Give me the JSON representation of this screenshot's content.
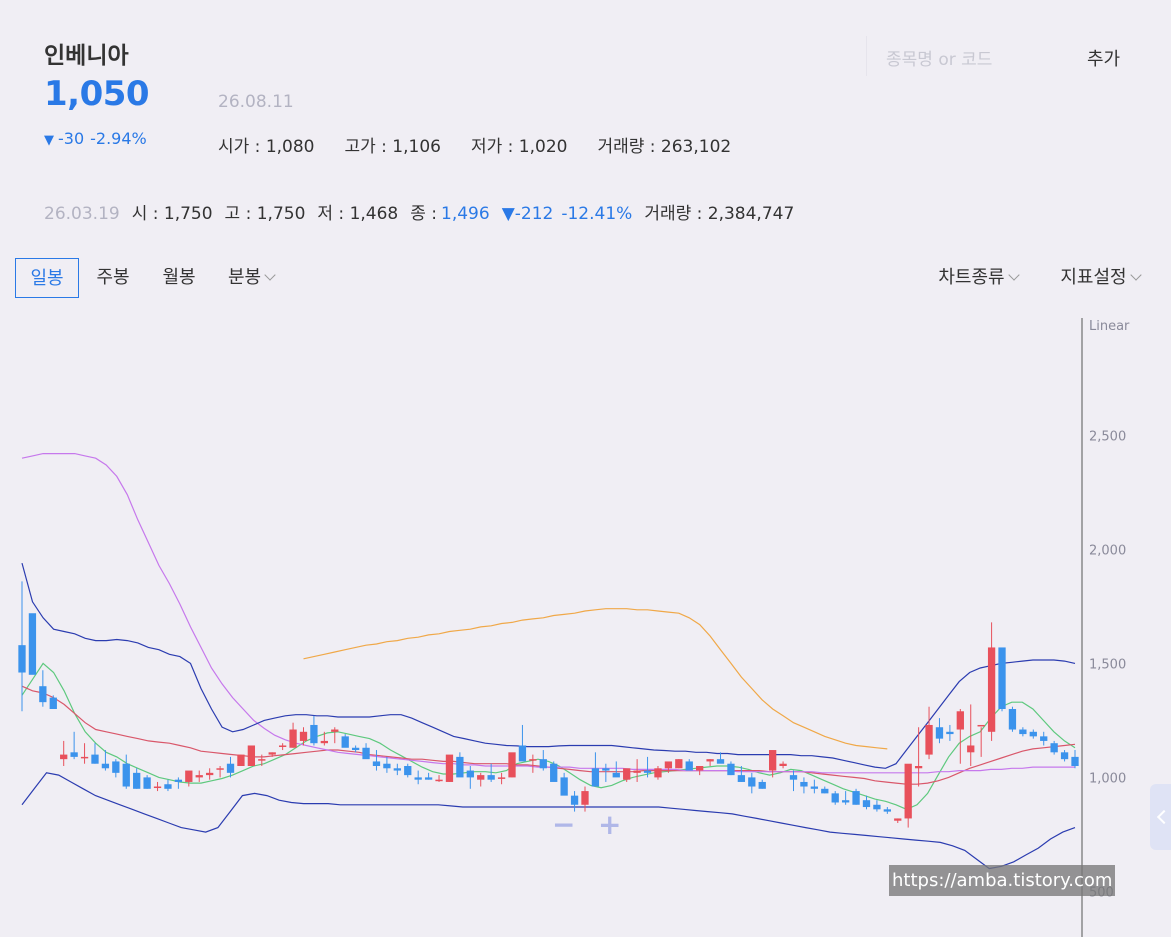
{
  "stock": {
    "name": "인베니아",
    "price": "1,050",
    "change_arrow": "▼",
    "change": "-30",
    "change_pct": "-2.94%",
    "date": "26.08.11",
    "open": "시가 : 1,080",
    "high": "고가 : 1,106",
    "low": "저가 : 1,020",
    "volume": "거래량 : 263,102"
  },
  "search": {
    "placeholder": "종목명 or 코드",
    "add_label": "추가"
  },
  "prev": {
    "date": "26.03.19",
    "open": "시 : 1,750",
    "high": "고 : 1,750",
    "low": "저 : 1,468",
    "close_label": "종 :",
    "close": "1,496",
    "change": "▼-212",
    "change_pct": "-12.41%",
    "volume": "거래량 : 2,384,747"
  },
  "tabs": {
    "daily": "일봉",
    "weekly": "주봉",
    "monthly": "월봉",
    "minute": "분봉"
  },
  "controls": {
    "chart_type": "차트종류",
    "indicators": "지표설정"
  },
  "zoom": {
    "out": "−",
    "in": "+"
  },
  "watermark": "https://amba.tistory.com",
  "colors": {
    "up": "#e8505b",
    "down": "#3b93ec",
    "accent": "#2a79e6"
  },
  "icons": [
    "chevron-down-icon",
    "chevron-left-icon"
  ],
  "chart_data": {
    "type": "candlestick",
    "scale": "Linear",
    "ylim": [
      300,
      3050
    ],
    "y_ticks": [
      {
        "v": 2500,
        "label": "2,500"
      },
      {
        "v": 2000,
        "label": "2,000"
      },
      {
        "v": 1500,
        "label": "1,500"
      },
      {
        "v": 1000,
        "label": "1,000"
      },
      {
        "v": 500,
        "label": "500"
      }
    ],
    "candles": [
      [
        1580,
        1290,
        1860,
        1460
      ],
      [
        1720,
        1580,
        1570,
        1450
      ],
      [
        1400,
        1470,
        1310,
        1330
      ],
      [
        1350,
        1360,
        1330,
        1300
      ],
      [
        1080,
        1160,
        1050,
        1100
      ],
      [
        1110,
        1200,
        1080,
        1090
      ],
      [
        1090,
        1150,
        1060,
        1090
      ],
      [
        1100,
        1150,
        1060,
        1060
      ],
      [
        1060,
        1120,
        1030,
        1040
      ],
      [
        1070,
        1080,
        1000,
        1020
      ],
      [
        1060,
        1100,
        950,
        960
      ],
      [
        1020,
        1040,
        950,
        950
      ],
      [
        1000,
        1010,
        950,
        950
      ],
      [
        960,
        980,
        940,
        960
      ],
      [
        970,
        990,
        940,
        950
      ],
      [
        990,
        1000,
        950,
        980
      ],
      [
        980,
        1020,
        960,
        1030
      ],
      [
        1000,
        1030,
        980,
        1010
      ],
      [
        1010,
        1040,
        990,
        1020
      ],
      [
        1040,
        1050,
        1000,
        1040
      ],
      [
        1060,
        1090,
        1000,
        1020
      ],
      [
        1050,
        1100,
        1050,
        1100
      ],
      [
        1050,
        1120,
        1050,
        1140
      ],
      [
        1080,
        1100,
        1050,
        1080
      ],
      [
        1100,
        1110,
        1090,
        1110
      ],
      [
        1140,
        1150,
        1120,
        1140
      ],
      [
        1130,
        1240,
        1130,
        1210
      ],
      [
        1160,
        1220,
        1140,
        1200
      ],
      [
        1230,
        1270,
        1140,
        1150
      ],
      [
        1150,
        1200,
        1140,
        1160
      ],
      [
        1200,
        1220,
        1150,
        1210
      ],
      [
        1180,
        1190,
        1140,
        1130
      ],
      [
        1130,
        1140,
        1110,
        1120
      ],
      [
        1130,
        1150,
        1100,
        1080
      ],
      [
        1070,
        1120,
        1030,
        1050
      ],
      [
        1060,
        1090,
        1020,
        1040
      ],
      [
        1040,
        1060,
        1010,
        1030
      ],
      [
        1050,
        1060,
        1000,
        1010
      ],
      [
        1000,
        1030,
        970,
        990
      ],
      [
        1000,
        1020,
        990,
        990
      ],
      [
        990,
        1010,
        980,
        990
      ],
      [
        980,
        1060,
        980,
        1100
      ],
      [
        1090,
        1110,
        1050,
        1000
      ],
      [
        1030,
        1050,
        950,
        1000
      ],
      [
        990,
        1020,
        960,
        1010
      ],
      [
        1010,
        1060,
        980,
        990
      ],
      [
        1000,
        1020,
        970,
        1000
      ],
      [
        1000,
        1100,
        1000,
        1110
      ],
      [
        1140,
        1230,
        1080,
        1070
      ],
      [
        1080,
        1100,
        1020,
        1080
      ],
      [
        1080,
        1120,
        1030,
        1040
      ],
      [
        1060,
        1070,
        1000,
        980
      ],
      [
        1000,
        1020,
        950,
        920
      ],
      [
        920,
        940,
        850,
        880
      ],
      [
        880,
        960,
        850,
        940
      ],
      [
        1040,
        1110,
        960,
        960
      ],
      [
        1040,
        1060,
        980,
        1030
      ],
      [
        1020,
        1070,
        1010,
        1000
      ],
      [
        990,
        1010,
        980,
        1040
      ],
      [
        1020,
        1080,
        980,
        1030
      ],
      [
        1030,
        1090,
        1000,
        1020
      ],
      [
        1000,
        1050,
        990,
        1040
      ],
      [
        1040,
        1060,
        1020,
        1070
      ],
      [
        1040,
        1080,
        1040,
        1080
      ],
      [
        1070,
        1080,
        1050,
        1030
      ],
      [
        1030,
        1040,
        1010,
        1050
      ],
      [
        1070,
        1080,
        1050,
        1080
      ],
      [
        1080,
        1110,
        1070,
        1060
      ],
      [
        1060,
        1070,
        1010,
        1010
      ],
      [
        1010,
        1050,
        980,
        980
      ],
      [
        1000,
        1020,
        930,
        960
      ],
      [
        980,
        990,
        950,
        950
      ],
      [
        1030,
        1040,
        1000,
        1120
      ],
      [
        1050,
        1070,
        1040,
        1060
      ],
      [
        1010,
        1030,
        940,
        990
      ],
      [
        980,
        1000,
        930,
        960
      ],
      [
        960,
        990,
        930,
        950
      ],
      [
        950,
        960,
        930,
        930
      ],
      [
        930,
        940,
        880,
        890
      ],
      [
        900,
        940,
        880,
        890
      ],
      [
        940,
        950,
        880,
        880
      ],
      [
        900,
        920,
        860,
        870
      ],
      [
        880,
        900,
        850,
        860
      ],
      [
        860,
        870,
        840,
        850
      ],
      [
        810,
        820,
        800,
        820
      ],
      [
        820,
        850,
        780,
        1060
      ],
      [
        1040,
        1220,
        960,
        1050
      ],
      [
        1100,
        1310,
        1080,
        1230
      ],
      [
        1220,
        1260,
        1150,
        1170
      ],
      [
        1200,
        1230,
        1160,
        1190
      ],
      [
        1210,
        1300,
        1060,
        1290
      ],
      [
        1110,
        1320,
        1050,
        1140
      ],
      [
        1230,
        1220,
        1090,
        1230
      ],
      [
        1200,
        1680,
        1160,
        1570
      ],
      [
        1570,
        1560,
        1290,
        1300
      ],
      [
        1300,
        1310,
        1200,
        1210
      ],
      [
        1210,
        1220,
        1180,
        1190
      ],
      [
        1200,
        1210,
        1170,
        1180
      ],
      [
        1180,
        1200,
        1140,
        1160
      ],
      [
        1150,
        1160,
        1100,
        1110
      ],
      [
        1110,
        1120,
        1070,
        1080
      ],
      [
        1090,
        1120,
        1040,
        1050
      ]
    ],
    "series": [
      {
        "kind": "ma",
        "color": "#5ec97e",
        "values": [
          1360,
          1430,
          1500,
          1460,
          1380,
          1280,
          1200,
          1150,
          1110,
          1090,
          1060,
          1040,
          1020,
          1000,
          990,
          980,
          975,
          975,
          985,
          995,
          1010,
          1030,
          1050,
          1060,
          1080,
          1100,
          1130,
          1160,
          1180,
          1195,
          1200,
          1190,
          1180,
          1170,
          1150,
          1120,
          1095,
          1070,
          1045,
          1025,
          1015,
          1015,
          1020,
          1025,
          1025,
          1020,
          1030,
          1060,
          1070,
          1080,
          1070,
          1050,
          1020,
          990,
          965,
          955,
          965,
          985,
          1000,
          1010,
          1020,
          1025,
          1030,
          1035,
          1040,
          1045,
          1050,
          1050,
          1045,
          1035,
          1020,
          1010,
          1020,
          1035,
          1030,
          1010,
          990,
          970,
          950,
          935,
          920,
          905,
          895,
          880,
          860,
          880,
          930,
          1010,
          1090,
          1150,
          1180,
          1200,
          1260,
          1310,
          1330,
          1330,
          1300,
          1250,
          1200,
          1160,
          1130
        ]
      },
      {
        "kind": "ma",
        "color": "#d9576a",
        "values": [
          1400,
          1380,
          1370,
          1350,
          1320,
          1280,
          1240,
          1210,
          1200,
          1190,
          1180,
          1170,
          1160,
          1155,
          1150,
          1140,
          1130,
          1115,
          1110,
          1105,
          1100,
          1095,
          1090,
          1090,
          1095,
          1100,
          1105,
          1110,
          1115,
          1120,
          1120,
          1115,
          1110,
          1100,
          1095,
          1090,
          1085,
          1080,
          1080,
          1075,
          1070,
          1070,
          1065,
          1060,
          1060,
          1060,
          1060,
          1055,
          1055,
          1050,
          1045,
          1040,
          1035,
          1030,
          1025,
          1025,
          1025,
          1025,
          1025,
          1030,
          1030,
          1030,
          1030,
          1030,
          1030,
          1030,
          1030,
          1030,
          1030,
          1030,
          1030,
          1025,
          1025,
          1025,
          1025,
          1020,
          1015,
          1010,
          1005,
          1000,
          995,
          985,
          980,
          975,
          970,
          970,
          975,
          985,
          1000,
          1020,
          1040,
          1055,
          1070,
          1085,
          1100,
          1115,
          1125,
          1130,
          1135,
          1140,
          1145
        ]
      },
      {
        "kind": "ma",
        "color": "#f0a848",
        "start": 27,
        "values": [
          1520,
          1530,
          1540,
          1550,
          1560,
          1570,
          1580,
          1585,
          1595,
          1600,
          1610,
          1615,
          1625,
          1630,
          1640,
          1645,
          1650,
          1660,
          1665,
          1675,
          1680,
          1690,
          1695,
          1700,
          1710,
          1715,
          1720,
          1730,
          1735,
          1740,
          1740,
          1740,
          1735,
          1735,
          1730,
          1725,
          1720,
          1700,
          1670,
          1620,
          1560,
          1500,
          1440,
          1390,
          1340,
          1300,
          1270,
          1240,
          1220,
          1200,
          1180,
          1165,
          1150,
          1140,
          1135,
          1130,
          1125
        ]
      },
      {
        "kind": "ma",
        "color": "#c678ec",
        "values": [
          2400,
          2410,
          2420,
          2420,
          2420,
          2420,
          2410,
          2400,
          2370,
          2320,
          2240,
          2130,
          2030,
          1930,
          1850,
          1760,
          1660,
          1570,
          1480,
          1410,
          1350,
          1300,
          1250,
          1215,
          1185,
          1165,
          1150,
          1140,
          1130,
          1120,
          1110,
          1105,
          1100,
          1095,
          1090,
          1085,
          1080,
          1075,
          1070,
          1065,
          1060,
          1060,
          1055,
          1055,
          1050,
          1050,
          1050,
          1050,
          1050,
          1045,
          1045,
          1045,
          1045,
          1040,
          1040,
          1040,
          1040,
          1040,
          1035,
          1035,
          1035,
          1035,
          1035,
          1030,
          1030,
          1030,
          1030,
          1030,
          1025,
          1025,
          1025,
          1025,
          1025,
          1025,
          1025,
          1025,
          1020,
          1020,
          1020,
          1020,
          1020,
          1020,
          1020,
          1020,
          1020,
          1020,
          1020,
          1025,
          1025,
          1030,
          1030,
          1030,
          1035,
          1035,
          1040,
          1040,
          1045,
          1045,
          1045,
          1045,
          1045
        ]
      },
      {
        "kind": "band",
        "color": "#2b3cb0",
        "values": [
          1940,
          1770,
          1700,
          1650,
          1640,
          1630,
          1610,
          1600,
          1600,
          1605,
          1600,
          1590,
          1570,
          1560,
          1540,
          1530,
          1500,
          1390,
          1300,
          1220,
          1200,
          1210,
          1230,
          1250,
          1260,
          1270,
          1275,
          1275,
          1270,
          1270,
          1265,
          1265,
          1265,
          1265,
          1270,
          1275,
          1275,
          1260,
          1240,
          1220,
          1200,
          1180,
          1170,
          1160,
          1150,
          1145,
          1140,
          1138,
          1135,
          1135,
          1135,
          1138,
          1140,
          1140,
          1140,
          1140,
          1140,
          1135,
          1130,
          1125,
          1120,
          1118,
          1115,
          1115,
          1110,
          1110,
          1105,
          1105,
          1100,
          1100,
          1100,
          1100,
          1100,
          1100,
          1095,
          1095,
          1090,
          1085,
          1075,
          1065,
          1055,
          1045,
          1040,
          1060,
          1120,
          1180,
          1240,
          1300,
          1360,
          1420,
          1460,
          1480,
          1490,
          1500,
          1505,
          1510,
          1515,
          1515,
          1515,
          1510,
          1500
        ]
      },
      {
        "kind": "band",
        "color": "#2b3cb0",
        "values": [
          880,
          950,
          1020,
          1010,
          980,
          950,
          920,
          900,
          880,
          860,
          840,
          820,
          800,
          780,
          770,
          760,
          780,
          850,
          920,
          930,
          920,
          900,
          890,
          885,
          885,
          885,
          880,
          880,
          880,
          880,
          880,
          880,
          880,
          880,
          880,
          875,
          870,
          870,
          870,
          870,
          870,
          870,
          870,
          870,
          870,
          870,
          870,
          870,
          870,
          870,
          870,
          870,
          870,
          865,
          860,
          855,
          850,
          845,
          840,
          830,
          820,
          810,
          800,
          790,
          780,
          770,
          760,
          755,
          750,
          745,
          740,
          735,
          730,
          725,
          720,
          715,
          700,
          680,
          640,
          600,
          610,
          630,
          660,
          690,
          730,
          760,
          780
        ]
      }
    ]
  }
}
